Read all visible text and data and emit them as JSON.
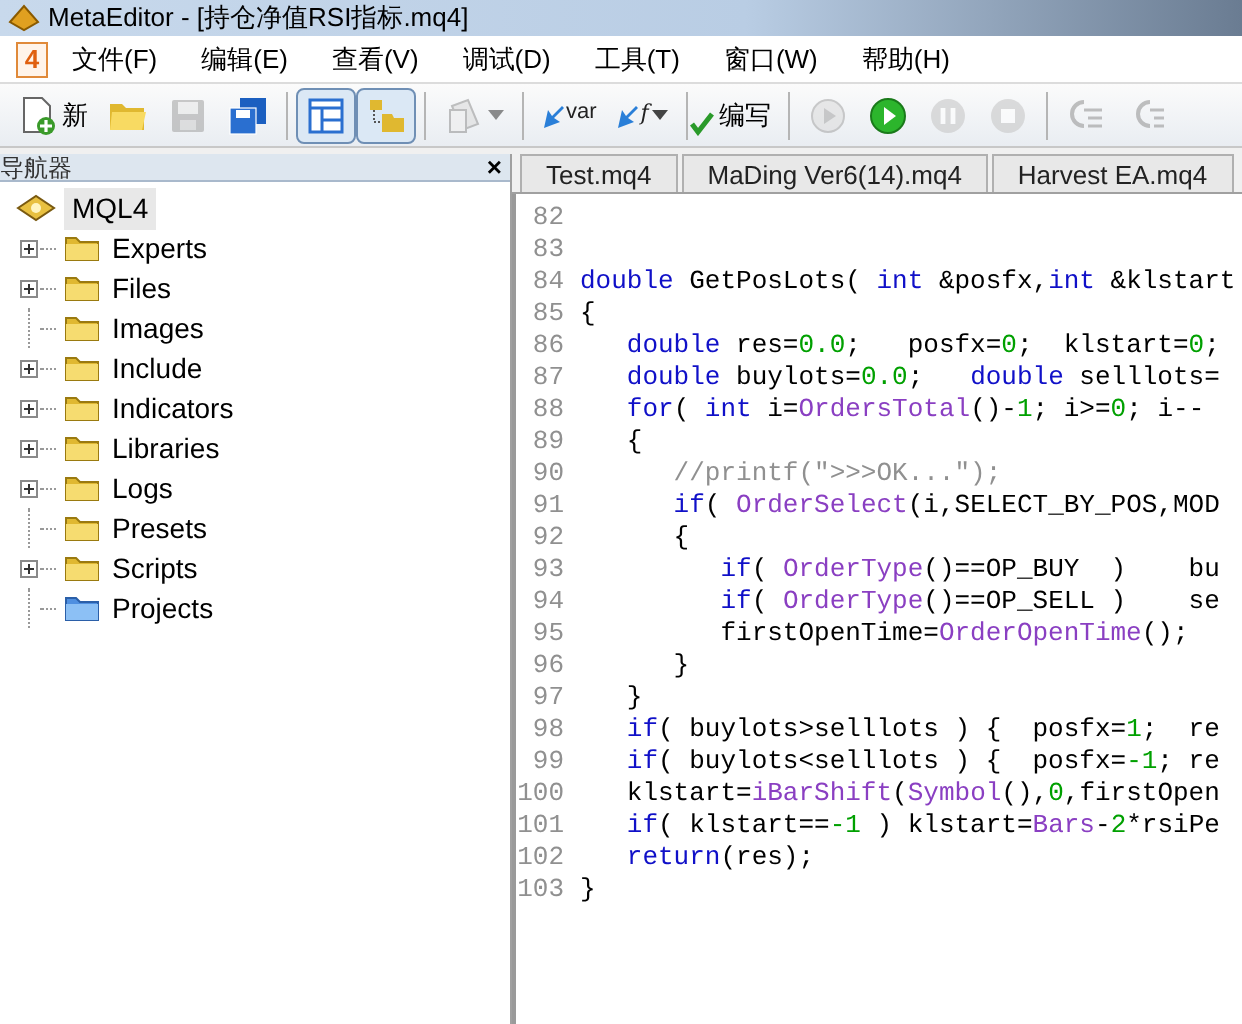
{
  "window": {
    "title": "MetaEditor - [持仓净值RSI指标.mq4]"
  },
  "menu": {
    "app_icon_label": "4",
    "items": [
      "文件(F)",
      "编辑(E)",
      "查看(V)",
      "调试(D)",
      "工具(T)",
      "窗口(W)",
      "帮助(H)"
    ]
  },
  "toolbar": [
    {
      "kind": "new",
      "label": "新",
      "pressed": false,
      "disabled": false,
      "dropdown": false
    },
    {
      "kind": "open",
      "pressed": false,
      "disabled": false,
      "dropdown": false
    },
    {
      "kind": "save",
      "pressed": false,
      "disabled": true,
      "dropdown": false
    },
    {
      "kind": "saveall",
      "pressed": false,
      "disabled": false,
      "dropdown": false
    },
    {
      "kind": "sep"
    },
    {
      "kind": "navigator",
      "pressed": true,
      "disabled": false,
      "dropdown": false
    },
    {
      "kind": "toolbox",
      "pressed": true,
      "disabled": false,
      "dropdown": false
    },
    {
      "kind": "sep"
    },
    {
      "kind": "styler",
      "pressed": false,
      "disabled": true,
      "dropdown": true
    },
    {
      "kind": "sep"
    },
    {
      "kind": "var",
      "label": "var",
      "pressed": false,
      "disabled": false,
      "dropdown": false
    },
    {
      "kind": "func",
      "label": "f",
      "pressed": false,
      "disabled": false,
      "dropdown": true
    },
    {
      "kind": "sep"
    },
    {
      "kind": "compile",
      "label": "编写",
      "pressed": false,
      "disabled": false,
      "dropdown": false
    },
    {
      "kind": "sep"
    },
    {
      "kind": "restart",
      "pressed": false,
      "disabled": true,
      "dropdown": false
    },
    {
      "kind": "play",
      "pressed": false,
      "disabled": false,
      "dropdown": false
    },
    {
      "kind": "pause",
      "pressed": false,
      "disabled": true,
      "dropdown": false
    },
    {
      "kind": "stop",
      "pressed": false,
      "disabled": true,
      "dropdown": false
    },
    {
      "kind": "sep"
    },
    {
      "kind": "stepin",
      "pressed": false,
      "disabled": true,
      "dropdown": false
    },
    {
      "kind": "stepover",
      "pressed": false,
      "disabled": true,
      "dropdown": false
    }
  ],
  "navigator": {
    "title": "导航器",
    "close": "×",
    "root": {
      "label": "MQL4",
      "selected": true,
      "children": [
        {
          "label": "Experts",
          "kind": "folder",
          "expandable": true
        },
        {
          "label": "Files",
          "kind": "folder",
          "expandable": true
        },
        {
          "label": "Images",
          "kind": "folder",
          "expandable": false
        },
        {
          "label": "Include",
          "kind": "folder",
          "expandable": true
        },
        {
          "label": "Indicators",
          "kind": "folder",
          "expandable": true
        },
        {
          "label": "Libraries",
          "kind": "folder",
          "expandable": true
        },
        {
          "label": "Logs",
          "kind": "folder",
          "expandable": true
        },
        {
          "label": "Presets",
          "kind": "folder",
          "expandable": false
        },
        {
          "label": "Scripts",
          "kind": "folder",
          "expandable": true
        },
        {
          "label": "Projects",
          "kind": "project",
          "expandable": false
        }
      ]
    }
  },
  "tabs": [
    {
      "label": "Test.mq4",
      "selected": false
    },
    {
      "label": "MaDing Ver6(14).mq4",
      "selected": false
    },
    {
      "label": "Harvest EA.mq4",
      "selected": false
    }
  ],
  "editor": {
    "lines": [
      {
        "number": "82"
      },
      {
        "number": "83"
      },
      {
        "number": "84",
        "tokens": [
          {
            "t": "double",
            "kind": "kw"
          },
          {
            "t": " GetPosLots( ",
            "kind": "p"
          },
          {
            "t": "int",
            "kind": "kw"
          },
          {
            "t": " &posfx,",
            "kind": "p"
          },
          {
            "t": "int",
            "kind": "kw"
          },
          {
            "t": " &klstart",
            "kind": "p"
          }
        ]
      },
      {
        "number": "85",
        "tokens": [
          {
            "t": "{",
            "kind": "p"
          }
        ]
      },
      {
        "number": "86",
        "tokens": [
          {
            "t": "   double",
            "kind": "kw"
          },
          {
            "t": " res=",
            "kind": "p"
          },
          {
            "t": "0.0",
            "kind": "num"
          },
          {
            "t": ";   posfx=",
            "kind": "p"
          },
          {
            "t": "0",
            "kind": "num"
          },
          {
            "t": ";  klstart=",
            "kind": "p"
          },
          {
            "t": "0",
            "kind": "num"
          },
          {
            "t": ";",
            "kind": "p"
          }
        ]
      },
      {
        "number": "87",
        "tokens": [
          {
            "t": "   double",
            "kind": "kw"
          },
          {
            "t": " buylots=",
            "kind": "p"
          },
          {
            "t": "0.0",
            "kind": "num"
          },
          {
            "t": ";   ",
            "kind": "p"
          },
          {
            "t": "double",
            "kind": "kw"
          },
          {
            "t": " selllots=",
            "kind": "p"
          }
        ]
      },
      {
        "number": "88",
        "tokens": [
          {
            "t": "   for",
            "kind": "kw"
          },
          {
            "t": "( ",
            "kind": "p"
          },
          {
            "t": "int",
            "kind": "kw"
          },
          {
            "t": " i=",
            "kind": "p"
          },
          {
            "t": "OrdersTotal",
            "kind": "fn"
          },
          {
            "t": "()-",
            "kind": "p"
          },
          {
            "t": "1",
            "kind": "num"
          },
          {
            "t": "; i>=",
            "kind": "p"
          },
          {
            "t": "0",
            "kind": "num"
          },
          {
            "t": "; i--",
            "kind": "p"
          }
        ]
      },
      {
        "number": "89",
        "tokens": [
          {
            "t": "   {",
            "kind": "p"
          }
        ]
      },
      {
        "number": "90",
        "tokens": [
          {
            "t": "      //printf(\">>>OK...\");",
            "kind": "cm"
          }
        ]
      },
      {
        "number": "91",
        "tokens": [
          {
            "t": "      if",
            "kind": "kw"
          },
          {
            "t": "( ",
            "kind": "p"
          },
          {
            "t": "OrderSelect",
            "kind": "fn"
          },
          {
            "t": "(i,SELECT_BY_POS,MOD",
            "kind": "p"
          }
        ]
      },
      {
        "number": "92",
        "tokens": [
          {
            "t": "      {",
            "kind": "p"
          }
        ]
      },
      {
        "number": "93",
        "tokens": [
          {
            "t": "         if",
            "kind": "kw"
          },
          {
            "t": "( ",
            "kind": "p"
          },
          {
            "t": "OrderType",
            "kind": "fn"
          },
          {
            "t": "()==OP_BUY  )    bu",
            "kind": "p"
          }
        ]
      },
      {
        "number": "94",
        "tokens": [
          {
            "t": "         if",
            "kind": "kw"
          },
          {
            "t": "( ",
            "kind": "p"
          },
          {
            "t": "OrderType",
            "kind": "fn"
          },
          {
            "t": "()==OP_SELL )    se",
            "kind": "p"
          }
        ]
      },
      {
        "number": "95",
        "tokens": [
          {
            "t": "         firstOpenTime=",
            "kind": "p"
          },
          {
            "t": "OrderOpenTime",
            "kind": "fn"
          },
          {
            "t": "();",
            "kind": "p"
          }
        ]
      },
      {
        "number": "96",
        "tokens": [
          {
            "t": "      }",
            "kind": "p"
          }
        ]
      },
      {
        "number": "97",
        "tokens": [
          {
            "t": "   }",
            "kind": "p"
          }
        ]
      },
      {
        "number": "98",
        "tokens": [
          {
            "t": "   if",
            "kind": "kw"
          },
          {
            "t": "( buylots>selllots ) {  posfx=",
            "kind": "p"
          },
          {
            "t": "1",
            "kind": "num"
          },
          {
            "t": ";  re",
            "kind": "p"
          }
        ]
      },
      {
        "number": "99",
        "tokens": [
          {
            "t": "   if",
            "kind": "kw"
          },
          {
            "t": "( buylots<selllots ) {  posfx=",
            "kind": "p"
          },
          {
            "t": "-1",
            "kind": "num"
          },
          {
            "t": "; re",
            "kind": "p"
          }
        ]
      },
      {
        "number": "100",
        "tokens": [
          {
            "t": "   klstart=",
            "kind": "p"
          },
          {
            "t": "iBarShift",
            "kind": "fn"
          },
          {
            "t": "(",
            "kind": "p"
          },
          {
            "t": "Symbol",
            "kind": "fn"
          },
          {
            "t": "(),",
            "kind": "p"
          },
          {
            "t": "0",
            "kind": "num"
          },
          {
            "t": ",firstOpen",
            "kind": "p"
          }
        ]
      },
      {
        "number": "101",
        "tokens": [
          {
            "t": "   if",
            "kind": "kw"
          },
          {
            "t": "( klstart==",
            "kind": "p"
          },
          {
            "t": "-1",
            "kind": "num"
          },
          {
            "t": " ) klstart=",
            "kind": "p"
          },
          {
            "t": "Bars",
            "kind": "fn"
          },
          {
            "t": "-",
            "kind": "p"
          },
          {
            "t": "2",
            "kind": "num"
          },
          {
            "t": "*rsiPe",
            "kind": "p"
          }
        ]
      },
      {
        "number": "102",
        "tokens": [
          {
            "t": "   return",
            "kind": "kw"
          },
          {
            "t": "(res);",
            "kind": "p"
          }
        ]
      },
      {
        "number": "103",
        "tokens": [
          {
            "t": "}",
            "kind": "p"
          }
        ]
      }
    ]
  }
}
